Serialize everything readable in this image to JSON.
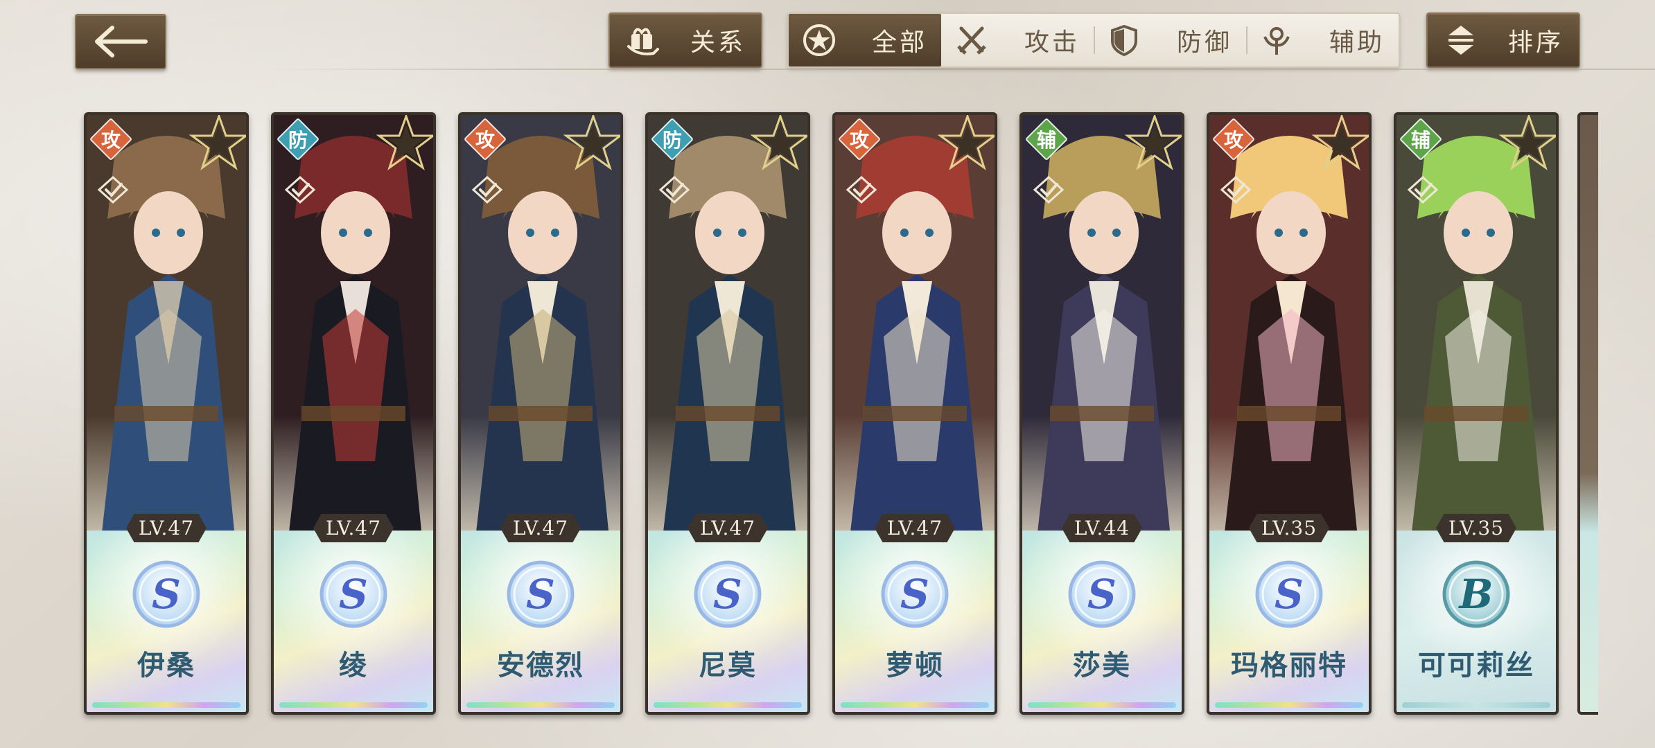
{
  "topbar": {
    "back_icon": "arrow-left-icon",
    "relation_label": "关系",
    "relation_icon": "gift-hand-icon",
    "filters": [
      {
        "label": "全部",
        "icon": "star-circle-icon",
        "active": true
      },
      {
        "label": "攻击",
        "icon": "crossed-swords-icon",
        "active": false
      },
      {
        "label": "防御",
        "icon": "shield-icon",
        "active": false
      },
      {
        "label": "辅助",
        "icon": "support-staff-icon",
        "active": false
      }
    ],
    "sort_label": "排序",
    "sort_icon": "sort-updown-icon"
  },
  "colors": {
    "attack": "#d7643b",
    "defense": "#3f9fb2",
    "support": "#5ea44a",
    "button_brown": "#5e4a35"
  },
  "characters": [
    {
      "name": "伊桑",
      "level": "LV.47",
      "rank": "S",
      "role": "攻",
      "role_type": "attack"
    },
    {
      "name": "绫",
      "level": "LV.47",
      "rank": "S",
      "role": "防",
      "role_type": "defense"
    },
    {
      "name": "安德烈",
      "level": "LV.47",
      "rank": "S",
      "role": "攻",
      "role_type": "attack"
    },
    {
      "name": "尼莫",
      "level": "LV.47",
      "rank": "S",
      "role": "防",
      "role_type": "defense"
    },
    {
      "name": "萝顿",
      "level": "LV.47",
      "rank": "S",
      "role": "攻",
      "role_type": "attack"
    },
    {
      "name": "莎美",
      "level": "LV.44",
      "rank": "S",
      "role": "辅",
      "role_type": "support"
    },
    {
      "name": "玛格丽特",
      "level": "LV.35",
      "rank": "S",
      "role": "攻",
      "role_type": "attack"
    },
    {
      "name": "可可莉丝",
      "level": "LV.35",
      "rank": "B",
      "role": "辅",
      "role_type": "support"
    }
  ]
}
